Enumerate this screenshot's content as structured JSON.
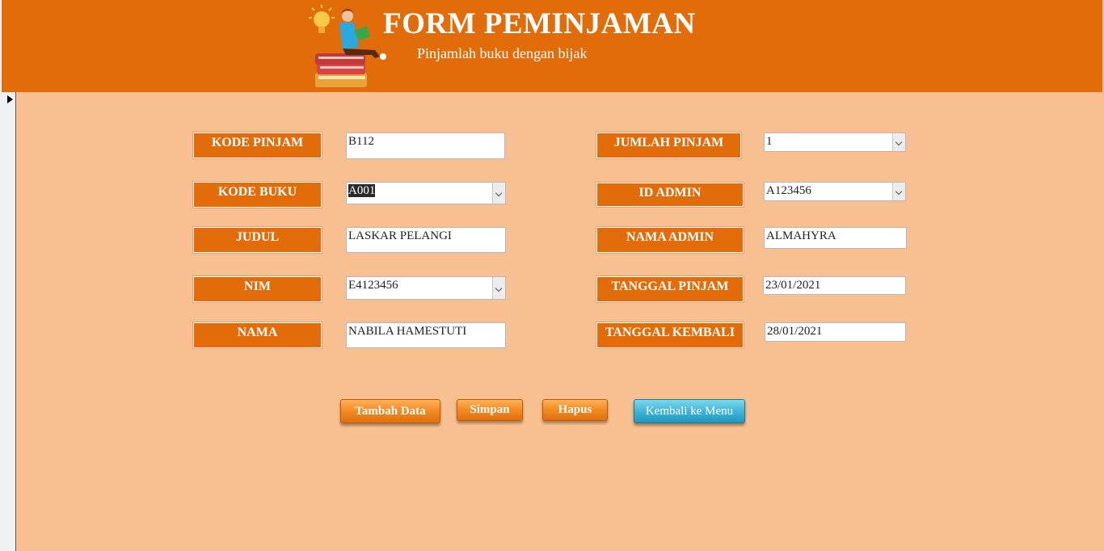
{
  "header": {
    "title": "FORM PEMINJAMAN",
    "subtitle": "Pinjamlah buku dengan bijak"
  },
  "form": {
    "kode_pinjam": {
      "label": "KODE PINJAM",
      "value": "B112"
    },
    "kode_buku": {
      "label": "KODE BUKU",
      "value": "A001"
    },
    "judul": {
      "label": "JUDUL",
      "value": "LASKAR PELANGI"
    },
    "nim": {
      "label": "NIM",
      "value": "E4123456"
    },
    "nama": {
      "label": "NAMA",
      "value": "NABILA HAMESTUTI"
    },
    "jumlah_pinjam": {
      "label": "JUMLAH PINJAM",
      "value": "1"
    },
    "id_admin": {
      "label": "ID ADMIN",
      "value": "A123456"
    },
    "nama_admin": {
      "label": "NAMA ADMIN",
      "value": "ALMAHYRA"
    },
    "tanggal_pinjam": {
      "label": "TANGGAL PINJAM",
      "value": "23/01/2021"
    },
    "tanggal_kembali": {
      "label": "TANGGAL KEMBALI",
      "value": "28/01/2021"
    }
  },
  "buttons": {
    "tambah": "Tambah Data",
    "simpan": "Simpan",
    "hapus": "Hapus",
    "kembali": "Kembali ke Menu"
  },
  "colors": {
    "header": "#e36c0a",
    "background": "#f8c090",
    "label": "#e36c0a",
    "button_orange": "#f28a22",
    "button_blue": "#3fb6d8"
  }
}
